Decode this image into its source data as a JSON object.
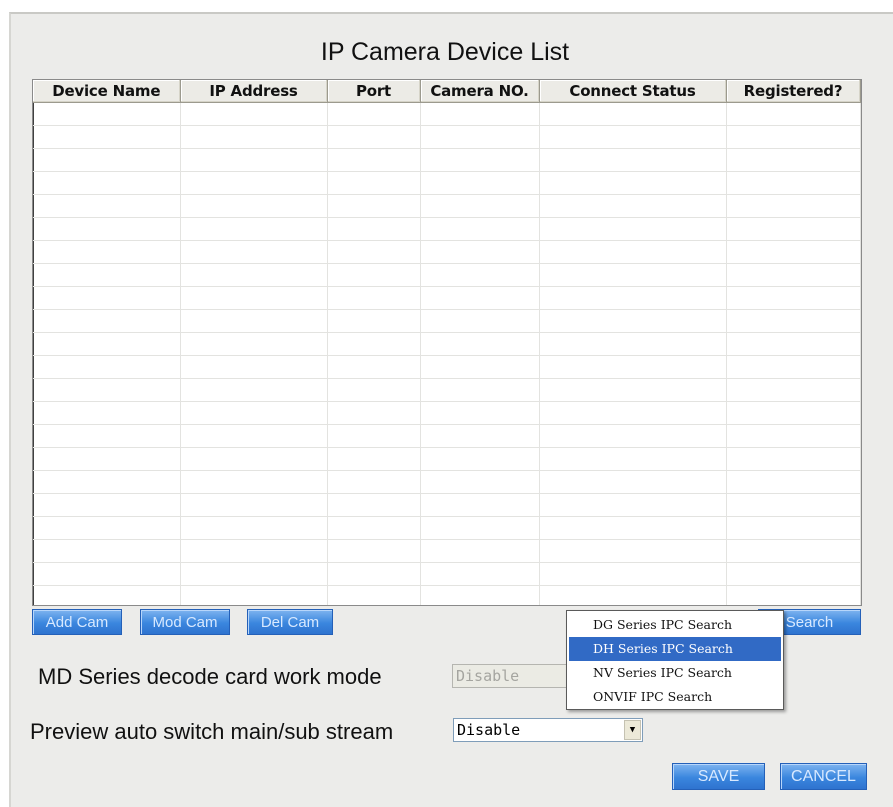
{
  "dialog": {
    "title": "IP Camera Device List"
  },
  "table": {
    "columns": [
      "Device Name",
      "IP Address",
      "Port",
      "Camera NO.",
      "Connect Status",
      "Registered?"
    ],
    "rows": []
  },
  "buttons": {
    "add_cam": "Add Cam",
    "mod_cam": "Mod Cam",
    "del_cam": "Del Cam",
    "search": "Search",
    "save": "SAVE",
    "cancel": "CANCEL"
  },
  "md_mode": {
    "label": "MD Series decode card work mode",
    "value": "Disable",
    "enabled": false
  },
  "preview_switch": {
    "label": "Preview auto switch main/sub stream",
    "value": "Disable"
  },
  "search_menu": {
    "items": [
      {
        "label": "DG Series IPC Search",
        "selected": false
      },
      {
        "label": "DH Series IPC Search",
        "selected": true
      },
      {
        "label": "NV Series IPC Search",
        "selected": false
      },
      {
        "label": "ONVIF IPC Search",
        "selected": false
      }
    ]
  },
  "colors": {
    "button_blue": "#3a86de",
    "menu_highlight": "#316ac5",
    "dialog_bg": "#ececea"
  }
}
